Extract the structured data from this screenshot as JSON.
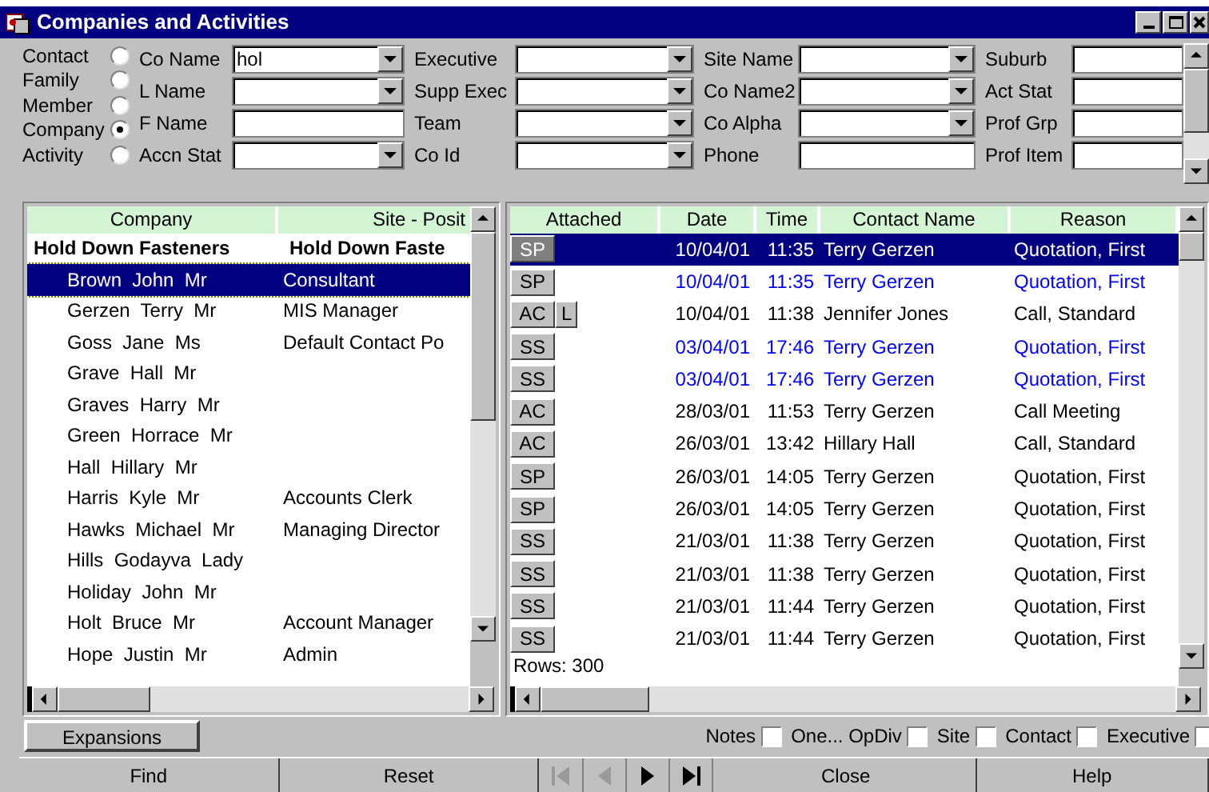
{
  "window": {
    "title": "Companies and Activities"
  },
  "modes": [
    {
      "label": "Contact",
      "selected": false
    },
    {
      "label": "Family",
      "selected": false
    },
    {
      "label": "Member",
      "selected": false
    },
    {
      "label": "Company",
      "selected": true
    },
    {
      "label": "Activity",
      "selected": false
    }
  ],
  "filters": [
    [
      {
        "label": "Co Name",
        "kind": "combo",
        "value": "hol"
      },
      {
        "label": "Executive",
        "kind": "combo"
      },
      {
        "label": "Site Name",
        "kind": "combo"
      },
      {
        "label": "Suburb",
        "kind": "text"
      }
    ],
    [
      {
        "label": "L Name",
        "kind": "combo"
      },
      {
        "label": "Supp Exec",
        "kind": "combo"
      },
      {
        "label": "Co Name2",
        "kind": "combo"
      },
      {
        "label": "Act Stat",
        "kind": "text"
      }
    ],
    [
      {
        "label": "F Name",
        "kind": "text"
      },
      {
        "label": "Team",
        "kind": "combo"
      },
      {
        "label": "Co Alpha",
        "kind": "combo"
      },
      {
        "label": "Prof Grp",
        "kind": "text"
      }
    ],
    [
      {
        "label": "Accn Stat",
        "kind": "combo"
      },
      {
        "label": "Co Id",
        "kind": "combo"
      },
      {
        "label": "Phone",
        "kind": "text"
      },
      {
        "label": "Prof Item",
        "kind": "text"
      }
    ]
  ],
  "contacts": {
    "columns": [
      "Company",
      "Site - Posit"
    ],
    "rows": [
      {
        "kind": "group",
        "cells": [
          "Hold Down Fasteners",
          "Hold Down Faste"
        ],
        "selected": false
      },
      {
        "kind": "person",
        "cells": [
          "Brown  John  Mr",
          "Consultant"
        ],
        "selected": true
      },
      {
        "kind": "person",
        "cells": [
          "Gerzen  Terry  Mr",
          "MIS Manager"
        ],
        "selected": false
      },
      {
        "kind": "person",
        "cells": [
          "Goss  Jane  Ms",
          "Default Contact Po"
        ],
        "selected": false
      },
      {
        "kind": "person",
        "cells": [
          "Grave  Hall  Mr",
          ""
        ],
        "selected": false
      },
      {
        "kind": "person",
        "cells": [
          "Graves  Harry  Mr",
          ""
        ],
        "selected": false
      },
      {
        "kind": "person",
        "cells": [
          "Green  Horrace  Mr",
          ""
        ],
        "selected": false
      },
      {
        "kind": "person",
        "cells": [
          "Hall  Hillary  Mr",
          ""
        ],
        "selected": false
      },
      {
        "kind": "person",
        "cells": [
          "Harris  Kyle  Mr",
          "Accounts Clerk"
        ],
        "selected": false
      },
      {
        "kind": "person",
        "cells": [
          "Hawks  Michael  Mr",
          "Managing Director"
        ],
        "selected": false
      },
      {
        "kind": "person",
        "cells": [
          "Hills  Godayva  Lady",
          ""
        ],
        "selected": false
      },
      {
        "kind": "person",
        "cells": [
          "Holiday  John  Mr",
          ""
        ],
        "selected": false
      },
      {
        "kind": "person",
        "cells": [
          "Holt  Bruce  Mr",
          "Account Manager"
        ],
        "selected": false
      },
      {
        "kind": "person",
        "cells": [
          "Hope  Justin  Mr",
          "Admin"
        ],
        "selected": false
      }
    ]
  },
  "activities": {
    "columns": [
      "Attached",
      "Date",
      "Time",
      "Contact Name",
      "Reason"
    ],
    "rows": [
      {
        "attached": [
          "SP"
        ],
        "date": "10/04/01",
        "time": "11:35",
        "contact": "Terry Gerzen",
        "reason": "Quotation, First",
        "selected": true
      },
      {
        "attached": [
          "SP"
        ],
        "date": "10/04/01",
        "time": "11:35",
        "contact": "Terry Gerzen",
        "reason": "Quotation, First",
        "color": "#0000ff",
        "selected": false
      },
      {
        "attached": [
          "AC",
          "L"
        ],
        "date": "10/04/01",
        "time": "11:38",
        "contact": "Jennifer Jones",
        "reason": "Call, Standard",
        "color": "#000000",
        "selected": false
      },
      {
        "attached": [
          "SS"
        ],
        "date": "03/04/01",
        "time": "17:46",
        "contact": "Terry Gerzen",
        "reason": "Quotation, First",
        "color": "#0000ff",
        "selected": false
      },
      {
        "attached": [
          "SS"
        ],
        "date": "03/04/01",
        "time": "17:46",
        "contact": "Terry Gerzen",
        "reason": "Quotation, First",
        "color": "#0000ff",
        "selected": false
      },
      {
        "attached": [
          "AC"
        ],
        "date": "28/03/01",
        "time": "11:53",
        "contact": "Terry Gerzen",
        "reason": "Call Meeting",
        "color": "#000000",
        "selected": false
      },
      {
        "attached": [
          "AC"
        ],
        "date": "26/03/01",
        "time": "13:42",
        "contact": "Hillary Hall",
        "reason": "Call, Standard",
        "color": "#000000",
        "selected": false
      },
      {
        "attached": [
          "SP"
        ],
        "date": "26/03/01",
        "time": "14:05",
        "contact": "Terry Gerzen",
        "reason": "Quotation, First",
        "color": "#000000",
        "selected": false
      },
      {
        "attached": [
          "SP"
        ],
        "date": "26/03/01",
        "time": "14:05",
        "contact": "Terry Gerzen",
        "reason": "Quotation, First",
        "color": "#000000",
        "selected": false
      },
      {
        "attached": [
          "SS"
        ],
        "date": "21/03/01",
        "time": "11:38",
        "contact": "Terry Gerzen",
        "reason": "Quotation, First",
        "color": "#000000",
        "selected": false
      },
      {
        "attached": [
          "SS"
        ],
        "date": "21/03/01",
        "time": "11:38",
        "contact": "Terry Gerzen",
        "reason": "Quotation, First",
        "color": "#000000",
        "selected": false
      },
      {
        "attached": [
          "SS"
        ],
        "date": "21/03/01",
        "time": "11:44",
        "contact": "Terry Gerzen",
        "reason": "Quotation, First",
        "color": "#000000",
        "selected": false
      },
      {
        "attached": [
          "SS"
        ],
        "date": "21/03/01",
        "time": "11:44",
        "contact": "Terry Gerzen",
        "reason": "Quotation, First",
        "color": "#000000",
        "selected": false
      }
    ],
    "row_count": "Rows: 300"
  },
  "expansions_button": "Expansions",
  "options": [
    {
      "label": "Notes",
      "checked": false
    },
    {
      "label": "One... OpDiv",
      "checked": false
    },
    {
      "label": "Site",
      "checked": false
    },
    {
      "label": "Contact",
      "checked": false
    },
    {
      "label": "Executive",
      "checked": false
    }
  ],
  "buttons": [
    {
      "kind": "text",
      "label": "Find"
    },
    {
      "kind": "text",
      "label": "Reset"
    },
    {
      "kind": "first",
      "disabled": true
    },
    {
      "kind": "prev",
      "disabled": true
    },
    {
      "kind": "next",
      "disabled": false
    },
    {
      "kind": "last",
      "disabled": false
    },
    {
      "kind": "text",
      "label": "Close"
    },
    {
      "kind": "text",
      "label": "Help"
    }
  ]
}
